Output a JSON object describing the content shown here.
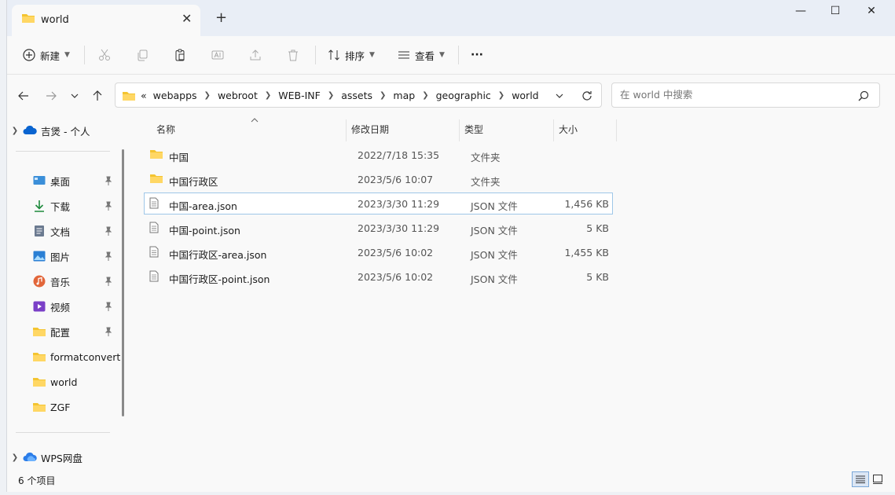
{
  "window": {
    "tab_title": "world",
    "tab_close": "✕",
    "new_tab": "+",
    "minimize": "—",
    "maximize": "☐",
    "close": "✕"
  },
  "toolbar": {
    "new_label": "新建",
    "sort_label": "排序",
    "view_label": "查看",
    "more_label": "···"
  },
  "address": {
    "prefix": "«",
    "crumbs": [
      "webapps",
      "webroot",
      "WEB-INF",
      "assets",
      "map",
      "geographic",
      "world"
    ]
  },
  "search": {
    "placeholder": "在 world 中搜索"
  },
  "sidebar": {
    "top": {
      "label": "吉煲 - 个人"
    },
    "items": [
      {
        "label": "桌面",
        "icon": "desktop-icon",
        "pinned": true
      },
      {
        "label": "下载",
        "icon": "download-icon",
        "pinned": true
      },
      {
        "label": "文档",
        "icon": "document-icon",
        "pinned": true
      },
      {
        "label": "图片",
        "icon": "picture-icon",
        "pinned": true
      },
      {
        "label": "音乐",
        "icon": "music-icon",
        "pinned": true
      },
      {
        "label": "视频",
        "icon": "video-icon",
        "pinned": true
      },
      {
        "label": "配置",
        "icon": "folder-icon",
        "pinned": true
      },
      {
        "label": "formatconvert",
        "icon": "folder-icon",
        "pinned": false
      },
      {
        "label": "world",
        "icon": "folder-icon",
        "pinned": false
      },
      {
        "label": "ZGF",
        "icon": "folder-icon",
        "pinned": false
      }
    ],
    "bottom": {
      "label": "WPS网盘"
    }
  },
  "columns": {
    "name": "名称",
    "modified": "修改日期",
    "type": "类型",
    "size": "大小"
  },
  "files": [
    {
      "name": "中国",
      "modified": "2022/7/18 15:35",
      "type": "文件夹",
      "size": "",
      "kind": "folder"
    },
    {
      "name": "中国行政区",
      "modified": "2023/5/6 10:07",
      "type": "文件夹",
      "size": "",
      "kind": "folder"
    },
    {
      "name": "中国-area.json",
      "modified": "2023/3/30 11:29",
      "type": "JSON 文件",
      "size": "1,456 KB",
      "kind": "file",
      "selected": true
    },
    {
      "name": "中国-point.json",
      "modified": "2023/3/30 11:29",
      "type": "JSON 文件",
      "size": "5 KB",
      "kind": "file"
    },
    {
      "name": "中国行政区-area.json",
      "modified": "2023/5/6 10:02",
      "type": "JSON 文件",
      "size": "1,455 KB",
      "kind": "file"
    },
    {
      "name": "中国行政区-point.json",
      "modified": "2023/5/6 10:02",
      "type": "JSON 文件",
      "size": "5 KB",
      "kind": "file"
    }
  ],
  "status": {
    "count": "6 个项目"
  },
  "colors": {
    "folder": "#f4c430",
    "selection_border": "#9fc7e8",
    "accent": "#0067c0"
  }
}
